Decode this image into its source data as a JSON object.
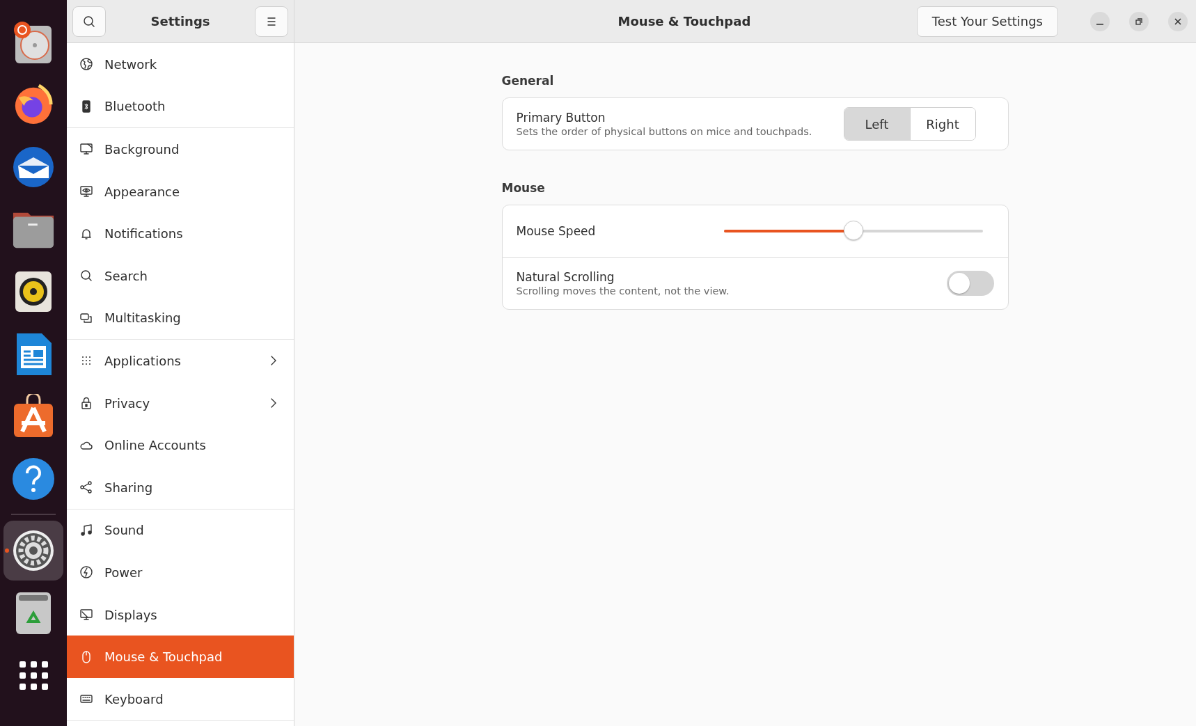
{
  "dock": [
    {
      "kind": "installer",
      "active": false
    },
    {
      "kind": "browser",
      "active": false
    },
    {
      "kind": "mail",
      "active": false
    },
    {
      "kind": "files",
      "active": false
    },
    {
      "kind": "music",
      "active": false
    },
    {
      "kind": "writer",
      "active": false
    },
    {
      "kind": "appstore",
      "active": false
    },
    {
      "kind": "help",
      "active": false
    },
    {
      "kind": "separator"
    },
    {
      "kind": "settings",
      "active": true
    },
    {
      "kind": "trash",
      "active": false
    },
    {
      "kind": "apps",
      "active": false
    }
  ],
  "sidebar": {
    "title": "Settings",
    "groups": [
      [
        {
          "label": "Network",
          "submenu": false,
          "selected": false
        },
        {
          "label": "Bluetooth",
          "submenu": false,
          "selected": false
        }
      ],
      [
        {
          "label": "Background",
          "submenu": false,
          "selected": false
        },
        {
          "label": "Appearance",
          "submenu": false,
          "selected": false
        },
        {
          "label": "Notifications",
          "submenu": false,
          "selected": false
        },
        {
          "label": "Search",
          "submenu": false,
          "selected": false
        },
        {
          "label": "Multitasking",
          "submenu": false,
          "selected": false
        }
      ],
      [
        {
          "label": "Applications",
          "submenu": true,
          "selected": false
        },
        {
          "label": "Privacy",
          "submenu": true,
          "selected": false
        },
        {
          "label": "Online Accounts",
          "submenu": false,
          "selected": false
        },
        {
          "label": "Sharing",
          "submenu": false,
          "selected": false
        }
      ],
      [
        {
          "label": "Sound",
          "submenu": false,
          "selected": false
        },
        {
          "label": "Power",
          "submenu": false,
          "selected": false
        },
        {
          "label": "Displays",
          "submenu": false,
          "selected": false
        },
        {
          "label": "Mouse & Touchpad",
          "submenu": false,
          "selected": true
        },
        {
          "label": "Keyboard",
          "submenu": false,
          "selected": false
        }
      ]
    ]
  },
  "window": {
    "title": "Mouse & Touchpad",
    "action_button": "Test Your Settings"
  },
  "sections": [
    {
      "heading": "General",
      "rows": [
        {
          "kind": "segmented",
          "title": "Primary Button",
          "subtitle": "Sets the order of physical buttons on mice and touchpads.",
          "options": [
            {
              "label": "Left",
              "selected": true
            },
            {
              "label": "Right",
              "selected": false
            }
          ]
        }
      ]
    },
    {
      "heading": "Mouse",
      "rows": [
        {
          "kind": "slider",
          "title": "Mouse Speed",
          "level": 0.5
        },
        {
          "kind": "switch",
          "title": "Natural Scrolling",
          "subtitle": "Scrolling moves the content, not the view.",
          "on": false
        }
      ]
    }
  ]
}
